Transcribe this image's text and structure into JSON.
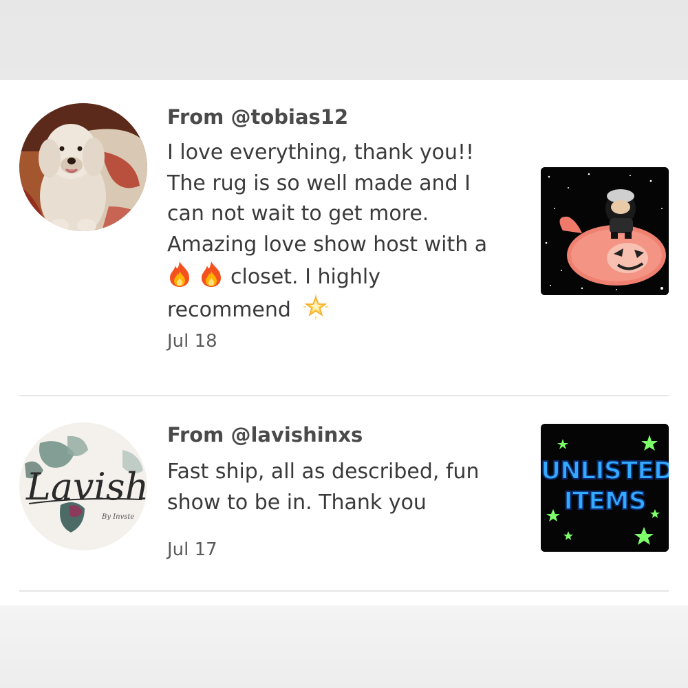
{
  "reviews": [
    {
      "from": "From @tobias12",
      "lines": [
        "I love everything, thank you!!",
        "The rug is so well made and I",
        "can not wait to get more.",
        "Amazing love show host with a",
        "closet. I highly",
        "recommend"
      ],
      "inline_icons": [
        "fire-emoji",
        "fire-emoji",
        "glowing-star-emoji"
      ],
      "date": "Jul 18",
      "avatar": "dog-photo",
      "thumbnail": "pink-rug-with-figure-photo"
    },
    {
      "from": "From @lavishinxs",
      "lines": [
        "Fast ship, all as described, fun",
        "show to be in. Thank you"
      ],
      "date": "Jul 17",
      "avatar": "lavish-logo",
      "avatar_logo_text": "Lavish",
      "avatar_logo_small": "By Invste",
      "thumbnail": "unlisted-items-graphic",
      "thumbnail_text_1": "UNLISTED",
      "thumbnail_text_2": "ITEMS"
    }
  ],
  "colors": {
    "accent_blue": "#33aaff",
    "star_green": "#7dff6a",
    "text_dark": "#3a3a3a",
    "divider": "#e6e6e6"
  }
}
